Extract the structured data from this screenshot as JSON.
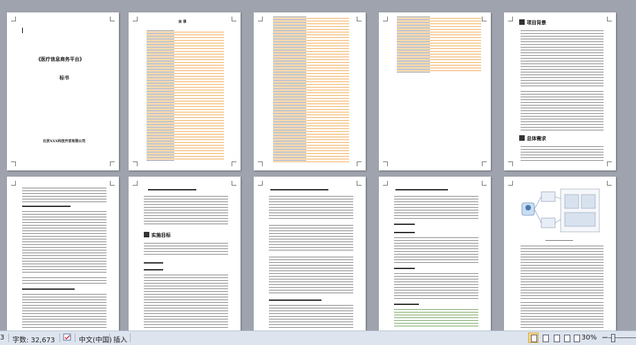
{
  "document": {
    "cover_title": "《医疗信息商务平台》",
    "cover_subtitle": "标书",
    "cover_company": "北京XXX科技开发有限公司",
    "toc_title": "目 录",
    "section_project_background": "项目背景",
    "section_overall_requirements": "总体需求",
    "section_implementation_goals": "实施目标"
  },
  "statusbar": {
    "page_num": "3",
    "word_count": "字数: 32,673",
    "language": "中文(中国)",
    "mode": "插入",
    "zoom": "30%",
    "zoom_out": "−",
    "zoom_in": "+",
    "spell_icon": "spellcheck-icon"
  }
}
